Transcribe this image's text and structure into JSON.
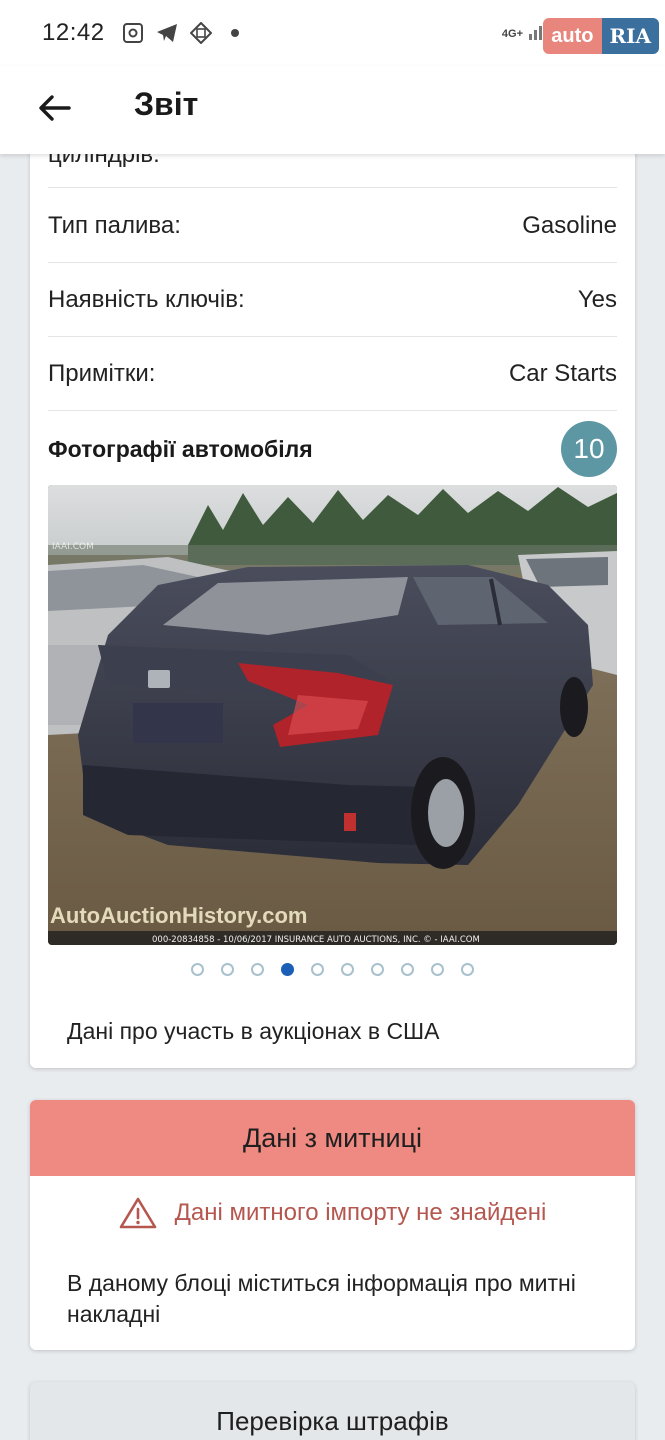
{
  "status_bar": {
    "time": "12:42",
    "network_label": "4G+",
    "icons": [
      "screenshot-icon",
      "telegram-icon",
      "vpn-icon"
    ]
  },
  "watermark": {
    "left": "auto",
    "right": "RIA"
  },
  "app_bar": {
    "title": "Звіт"
  },
  "specs": {
    "cut_label": "циліндрів:",
    "rows": [
      {
        "label": "Тип палива:",
        "value": "Gasoline"
      },
      {
        "label": "Наявність ключів:",
        "value": "Yes"
      },
      {
        "label": "Примітки:",
        "value": "Car Starts"
      }
    ]
  },
  "photos": {
    "title": "Фотографії автомобіля",
    "count": "10",
    "current_index": 3,
    "total_dots": 10,
    "watermark_line": "IAAI.COM",
    "site_brand": "AutoAuctionHistory.com",
    "caption": "000-20834858 - 10/06/2017 INSURANCE AUTO AUCTIONS, INC. © - IAAI.COM"
  },
  "auction": {
    "text": "Дані про участь в аукціонах в США"
  },
  "customs": {
    "header": "Дані з митниці",
    "warning": "Дані митного імпорту не знайдені",
    "description": "В даному блоці міститься інформація про митні накладні"
  },
  "fines": {
    "title": "Перевірка штрафів"
  },
  "colors": {
    "accent_teal": "#5c97a3",
    "customs_header": "#ef8a82",
    "warning_text": "#b5574f",
    "active_dot": "#1c5fb6"
  }
}
